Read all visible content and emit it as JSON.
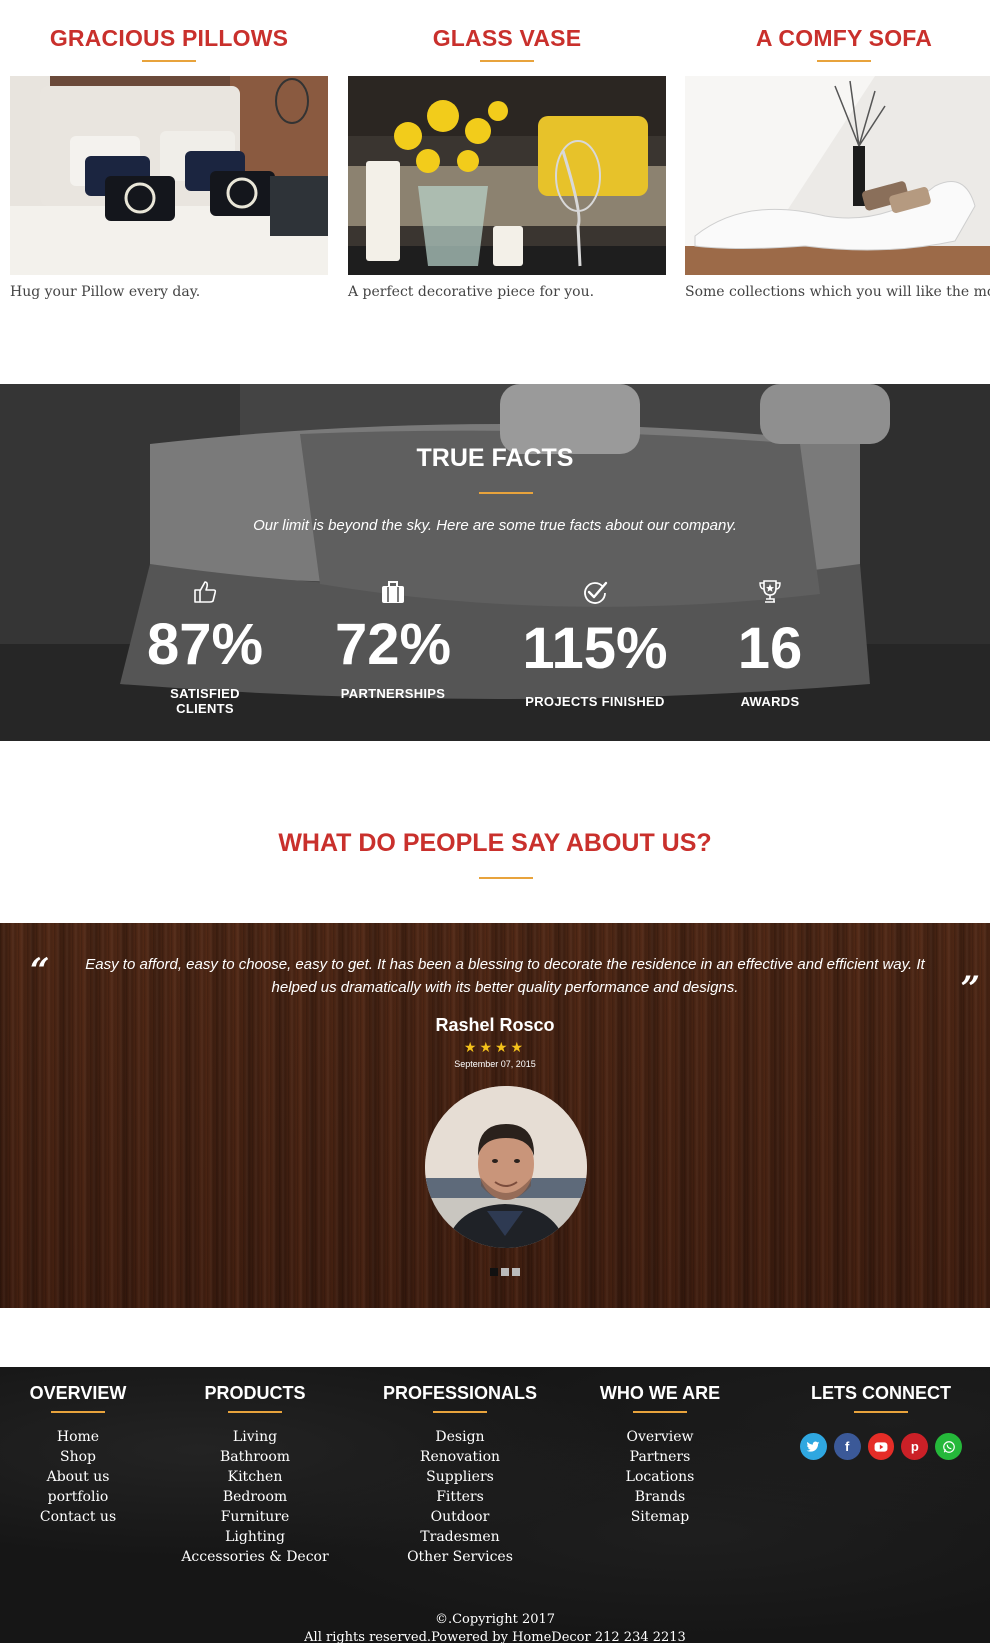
{
  "products": [
    {
      "title": "GRACIOUS PILLOWS",
      "description": "Hug your Pillow every day."
    },
    {
      "title": "GLASS VASE",
      "description": "A perfect decorative piece for you."
    },
    {
      "title": "A COMFY SOFA",
      "description": "Some collections which you will like the most"
    }
  ],
  "facts": {
    "title": "TRUE FACTS",
    "subtitle": "Our limit is beyond the sky. Here are some true facts about our company.",
    "items": [
      {
        "icon": "thumbs-up-icon",
        "value": "87%",
        "label": "SATISFIED CLIENTS"
      },
      {
        "icon": "briefcase-icon",
        "value": "72%",
        "label": "PARTNERSHIPS"
      },
      {
        "icon": "check-circle-icon",
        "value": "115%",
        "label": "PROJECTS FINISHED"
      },
      {
        "icon": "trophy-icon",
        "value": "16",
        "label": "AWARDS"
      }
    ]
  },
  "testimonials": {
    "title": "WHAT DO PEOPLE SAY ABOUT US?",
    "quote": "Easy to afford, easy to choose, easy to get. It has been a blessing to decorate the residence in an effective and efficient way. It helped us dramatically with its better quality performance and designs.",
    "author": "Rashel Rosco",
    "stars": "★★★★",
    "rating": 4,
    "date": "September 07, 2015",
    "active_slide": 1,
    "slide_count": 3
  },
  "footer": {
    "columns": [
      {
        "title": "OVERVIEW",
        "links": [
          "Home",
          "Shop",
          "About us",
          "portfolio",
          "Contact us"
        ]
      },
      {
        "title": "PRODUCTS",
        "links": [
          "Living",
          "Bathroom",
          "Kitchen",
          "Bedroom",
          "Furniture",
          "Lighting",
          "Accessories & Decor"
        ]
      },
      {
        "title": "PROFESSIONALS",
        "links": [
          "Design",
          "Renovation",
          "Suppliers",
          "Fitters",
          "Outdoor",
          "Tradesmen",
          "Other Services"
        ]
      },
      {
        "title": "WHO WE ARE",
        "links": [
          "Overview",
          "Partners",
          "Locations",
          "Brands",
          "Sitemap"
        ]
      }
    ],
    "connect": {
      "title": "LETS CONNECT",
      "networks": [
        {
          "icon": "twitter-icon",
          "color": "#2fa7e0"
        },
        {
          "icon": "facebook-icon",
          "color": "#3b5998"
        },
        {
          "icon": "youtube-icon",
          "color": "#e52d27"
        },
        {
          "icon": "pinterest-icon",
          "color": "#cb2027"
        },
        {
          "icon": "whatsapp-icon",
          "color": "#25b83a"
        }
      ]
    },
    "copyright_line1": "©.Copyright 2017",
    "copyright_line2": "All rights reserved.Powered by HomeDecor 212 234 2213"
  },
  "colors": {
    "heading_red": "#c9302c",
    "accent_orange": "#e8a33c",
    "star": "#f4c21b"
  }
}
